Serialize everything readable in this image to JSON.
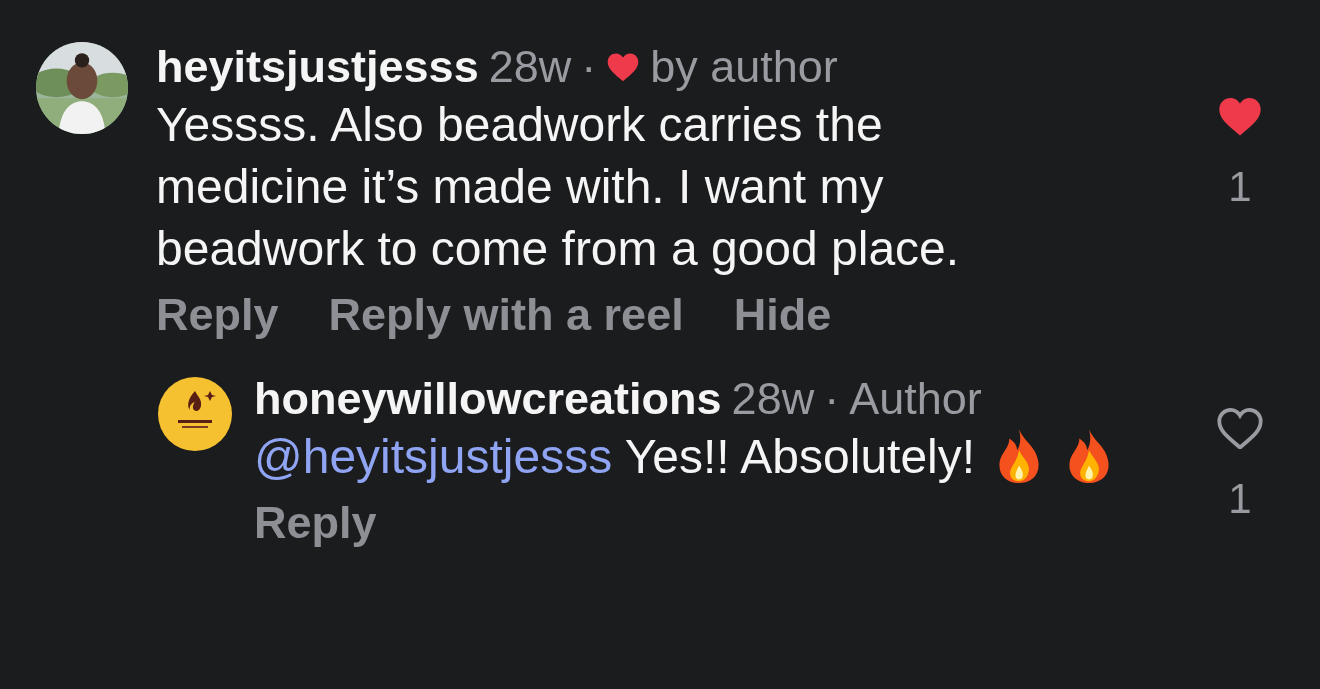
{
  "comments": [
    {
      "username": "heyitsjustjesss",
      "time": "28w",
      "separator": "·",
      "author_liked": true,
      "author_like_label": "by author",
      "text": "Yessss. Also beadwork carries the medicine it’s made with. I want my beadwork to come from a good place.",
      "actions": [
        "Reply",
        "Reply with a reel",
        "Hide"
      ],
      "liked": true,
      "like_count": "1",
      "replies": [
        {
          "username": "honeywillowcreations",
          "time": "28w",
          "separator": "·",
          "badge": "Author",
          "mention": "@heyitsjustjesss",
          "text": "Yes!! Absolutely!",
          "emojis": [
            {
              "kind": "fire"
            },
            {
              "kind": "fire"
            }
          ],
          "actions": [
            "Reply"
          ],
          "liked": false,
          "like_count": "1"
        }
      ]
    }
  ]
}
